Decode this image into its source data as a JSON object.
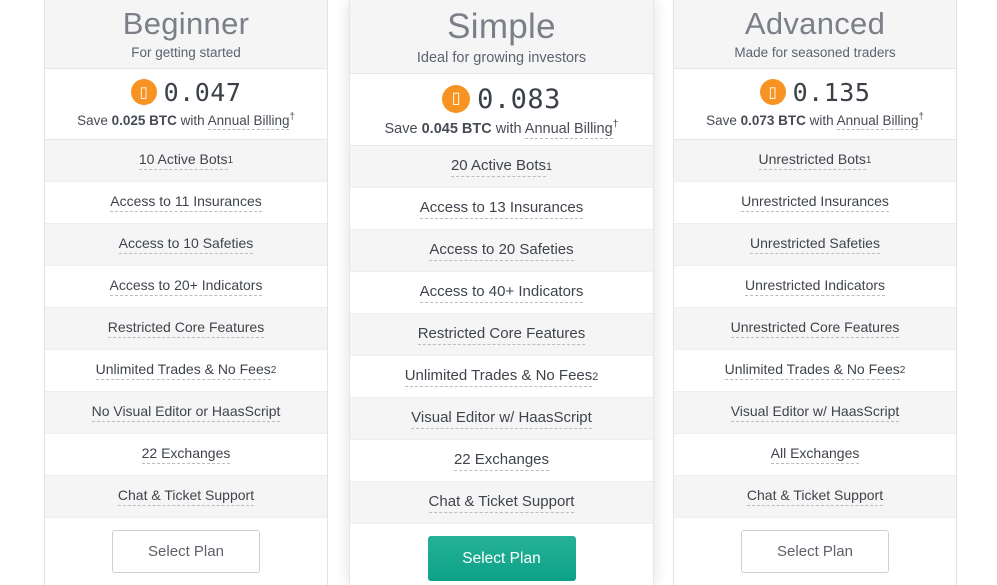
{
  "currency_icon": "bitcoin-icon",
  "accent_orange": "#f79322",
  "accent_teal": "#0da287",
  "header_bg": "#f5f5f5",
  "row_shade_bg": "#f5f5f5",
  "plans": [
    {
      "id": "beginner",
      "title": "Beginner",
      "subtitle": "For getting started",
      "price": "0.047",
      "save_prefix": "Save ",
      "save_amount": "0.025 BTC",
      "save_middle": " with ",
      "save_link": "Annual Billing",
      "save_sup": "†",
      "features": [
        {
          "label": "10 Active Bots",
          "sup": "1"
        },
        {
          "label": "Access to 11 Insurances",
          "sup": ""
        },
        {
          "label": "Access to 10 Safeties",
          "sup": ""
        },
        {
          "label": "Access to 20+ Indicators",
          "sup": ""
        },
        {
          "label": "Restricted Core Features",
          "sup": ""
        },
        {
          "label": "Unlimited Trades & No Fees",
          "sup": "2"
        },
        {
          "label": "No Visual Editor or HaasScript",
          "sup": ""
        },
        {
          "label": "22 Exchanges",
          "sup": ""
        },
        {
          "label": "Chat & Ticket Support",
          "sup": ""
        }
      ],
      "cta": "Select Plan",
      "cta_style": "outline"
    },
    {
      "id": "simple",
      "title": "Simple",
      "subtitle": "Ideal for growing investors",
      "price": "0.083",
      "save_prefix": "Save ",
      "save_amount": "0.045 BTC",
      "save_middle": " with ",
      "save_link": "Annual Billing",
      "save_sup": "†",
      "features": [
        {
          "label": "20 Active Bots",
          "sup": "1"
        },
        {
          "label": "Access to 13 Insurances",
          "sup": ""
        },
        {
          "label": "Access to 20 Safeties",
          "sup": ""
        },
        {
          "label": "Access to 40+ Indicators",
          "sup": ""
        },
        {
          "label": "Restricted Core Features",
          "sup": ""
        },
        {
          "label": "Unlimited Trades & No Fees",
          "sup": "2"
        },
        {
          "label": "Visual Editor w/ HaasScript",
          "sup": ""
        },
        {
          "label": "22 Exchanges",
          "sup": ""
        },
        {
          "label": "Chat & Ticket Support",
          "sup": ""
        }
      ],
      "cta": "Select Plan",
      "cta_style": "filled"
    },
    {
      "id": "advanced",
      "title": "Advanced",
      "subtitle": "Made for seasoned traders",
      "price": "0.135",
      "save_prefix": "Save ",
      "save_amount": "0.073 BTC",
      "save_middle": " with ",
      "save_link": "Annual Billing",
      "save_sup": "†",
      "features": [
        {
          "label": "Unrestricted Bots",
          "sup": "1"
        },
        {
          "label": "Unrestricted Insurances",
          "sup": ""
        },
        {
          "label": "Unrestricted Safeties",
          "sup": ""
        },
        {
          "label": "Unrestricted Indicators",
          "sup": ""
        },
        {
          "label": "Unrestricted Core Features",
          "sup": ""
        },
        {
          "label": "Unlimited Trades & No Fees",
          "sup": "2"
        },
        {
          "label": "Visual Editor w/ HaasScript",
          "sup": ""
        },
        {
          "label": "All Exchanges",
          "sup": ""
        },
        {
          "label": "Chat & Ticket Support",
          "sup": ""
        }
      ],
      "cta": "Select Plan",
      "cta_style": "outline"
    }
  ]
}
